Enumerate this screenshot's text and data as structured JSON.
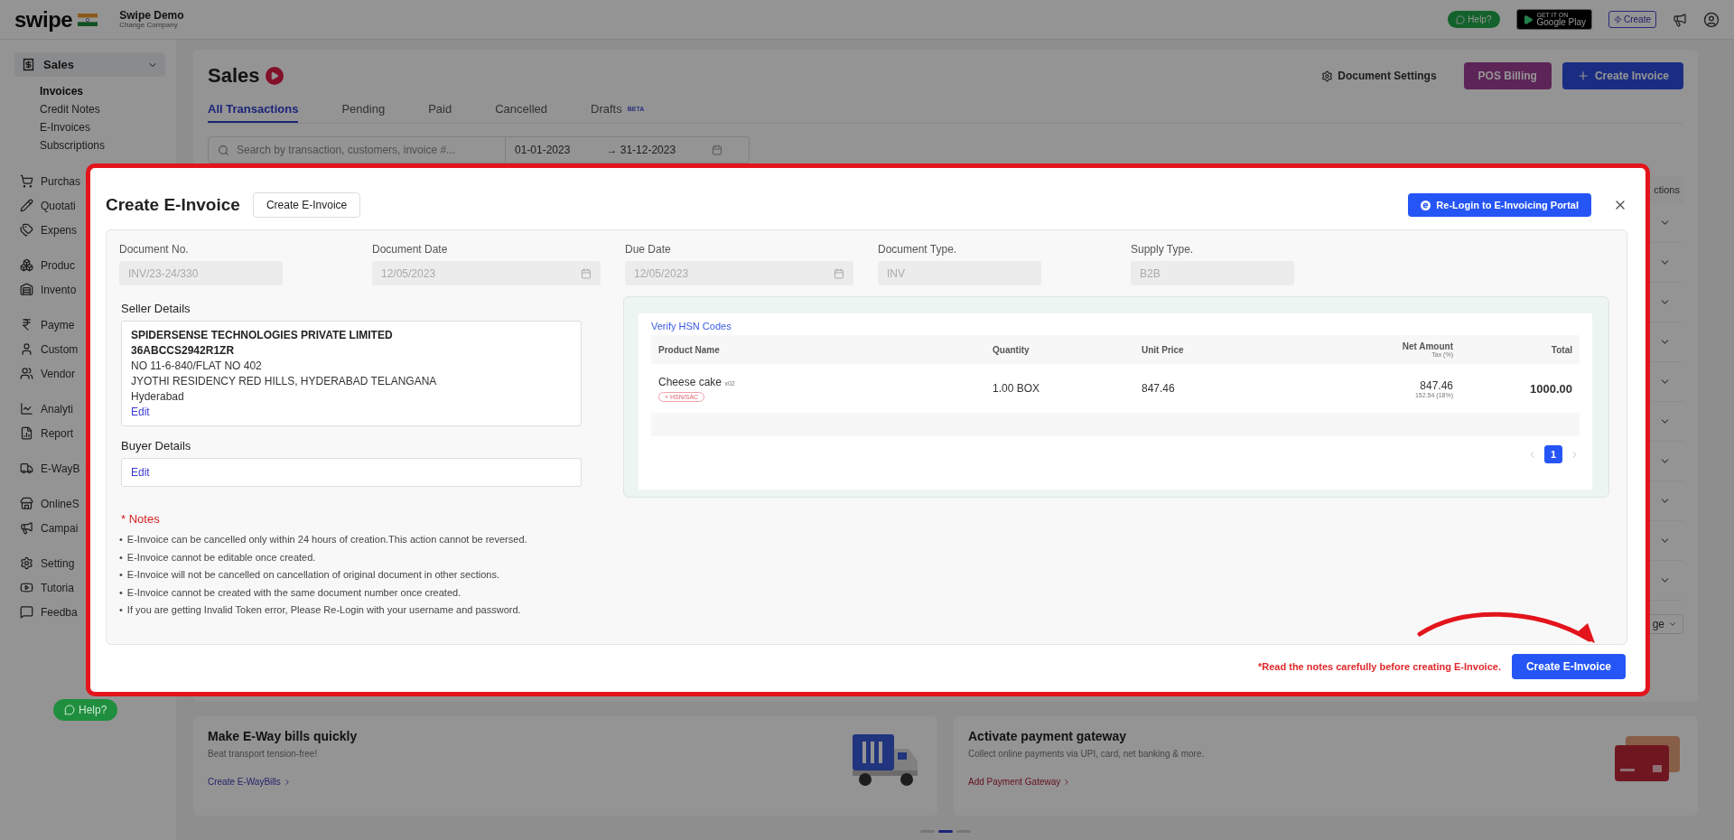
{
  "topbar": {
    "logo": "swipe",
    "company": "Swipe Demo",
    "change_company": "Change Company",
    "help": "Help?",
    "store_badge": {
      "small": "GET IT ON",
      "name": "Google Play"
    },
    "create": "Create"
  },
  "sidebar": {
    "items": [
      {
        "label": "Sales",
        "expanded": true,
        "children": [
          {
            "label": "Invoices",
            "selected": true
          },
          {
            "label": "Credit Notes",
            "selected": false
          },
          {
            "label": "E-Invoices",
            "selected": false
          },
          {
            "label": "Subscriptions",
            "selected": false
          }
        ]
      },
      {
        "label": "Purchas",
        "group_start": true
      },
      {
        "label": "Quotati"
      },
      {
        "label": "Expens"
      },
      {
        "label": "Produc",
        "group_start": true
      },
      {
        "label": "Invento"
      },
      {
        "label": "Payme",
        "group_start": true
      },
      {
        "label": "Custom"
      },
      {
        "label": "Vendor"
      },
      {
        "label": "Analyti",
        "group_start": true
      },
      {
        "label": "Report"
      },
      {
        "label": "E-WayB",
        "group_start": true
      },
      {
        "label": "OnlineS",
        "group_start": true
      },
      {
        "label": "Campai"
      },
      {
        "label": "Setting",
        "group_start": true
      },
      {
        "label": "Tutoria"
      },
      {
        "label": "Feedba"
      }
    ],
    "help": "Help?"
  },
  "page": {
    "title": "Sales",
    "document_settings": "Document Settings",
    "pos_billing": "POS Billing",
    "create_invoice": "Create Invoice",
    "tabs": [
      {
        "label": "All Transactions",
        "selected": true
      },
      {
        "label": "Pending",
        "selected": false
      },
      {
        "label": "Paid",
        "selected": false
      },
      {
        "label": "Cancelled",
        "selected": false
      },
      {
        "label": "Drafts",
        "selected": false,
        "badge": "BETA"
      }
    ],
    "search": {
      "placeholder": "Search by transaction, customers, invoice #..."
    },
    "date_from": "01-01-2023",
    "date_separator": "→",
    "date_to": "31-12-2023",
    "table": {
      "column_actions": "ctions",
      "pagination_fragment": "ge"
    },
    "cards": [
      {
        "title": "Make E-Way bills quickly",
        "text": "Beat transport tension-free!",
        "link": "Create E-WayBills",
        "kind": "truck"
      },
      {
        "title": "Activate payment gateway",
        "text": "Collect online payments via UPI, card, net banking & more.",
        "link": "Add Payment Gateway",
        "kind": "card"
      }
    ]
  },
  "dialog": {
    "title": "Create E-Invoice",
    "title_button": "Create E-Invoice",
    "relogin": "Re-Login to E-Invoicing Portal",
    "fields": [
      {
        "label": "Document No.",
        "value": "INV/23-24/330",
        "kind": "text"
      },
      {
        "label": "Document Date",
        "value": "12/05/2023",
        "kind": "date"
      },
      {
        "label": "Due Date",
        "value": "12/05/2023",
        "kind": "date"
      },
      {
        "label": "Document Type.",
        "value": "INV",
        "kind": "text"
      },
      {
        "label": "Supply Type.",
        "value": "B2B",
        "kind": "text"
      }
    ],
    "seller": {
      "heading": "Seller Details",
      "name": "SPIDERSENSE TECHNOLOGIES PRIVATE LIMITED",
      "gstin": "36ABCCS2942R1ZR",
      "lines": [
        "NO 11-6-840/FLAT NO 402",
        "JYOTHI RESIDENCY RED HILLS, HYDERABAD TELANGANA",
        "Hyderabad"
      ],
      "edit": "Edit"
    },
    "buyer": {
      "heading": "Buyer Details",
      "edit": "Edit"
    },
    "items": {
      "verify": "Verify HSN Codes",
      "columns": [
        "Product Name",
        "Quantity",
        "Unit Price",
        "Net Amount",
        "Total"
      ],
      "net_sub": "Tax (%)",
      "rows": [
        {
          "product": "Cheese cake",
          "code": "x02",
          "hsn": "+ HSN/SAC",
          "quantity": "1.00 BOX",
          "unit_price": "847.46",
          "net": "847.46",
          "tax": "152.54 (18%)",
          "total": "1000.00"
        }
      ],
      "pages": [
        {
          "label": "1",
          "selected": true
        }
      ]
    },
    "notes": {
      "heading": "* Notes",
      "bullet": "•",
      "items": [
        "E-Invoice can be cancelled only within 24 hours of creation.This action cannot be reversed.",
        "E-Invoice cannot be editable once created.",
        "E-Invoice will not be cancelled on cancellation of original document in other sections.",
        "E-Invoice cannot be created with the same document number once created.",
        "If you are getting Invalid Token error, Please Re-Login with your username and password."
      ]
    },
    "footer_note": "*Read the notes carefully before creating E-Invoice.",
    "submit": "Create E-Invoice"
  }
}
